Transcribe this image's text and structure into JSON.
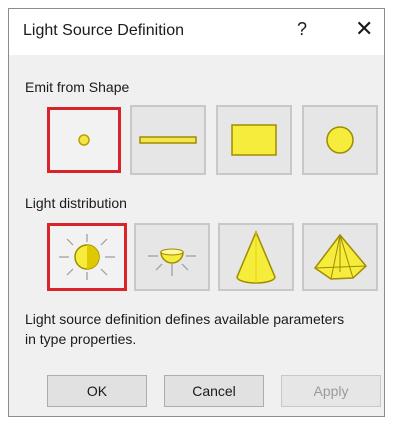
{
  "dialog": {
    "title": "Light Source Definition",
    "help_label": "?",
    "close_label": "✕"
  },
  "emit_from_shape": {
    "label": "Emit from Shape",
    "options": [
      {
        "icon": "point-light-icon",
        "selected": true
      },
      {
        "icon": "line-light-icon",
        "selected": false
      },
      {
        "icon": "rectangle-light-icon",
        "selected": false
      },
      {
        "icon": "circle-light-icon",
        "selected": false
      }
    ]
  },
  "light_distribution": {
    "label": "Light distribution",
    "options": [
      {
        "icon": "spherical-distribution-icon",
        "selected": true
      },
      {
        "icon": "hemispherical-distribution-icon",
        "selected": false
      },
      {
        "icon": "spot-cone-distribution-icon",
        "selected": false
      },
      {
        "icon": "photometric-web-distribution-icon",
        "selected": false
      }
    ]
  },
  "description": "Light source definition defines available parameters in type properties.",
  "buttons": {
    "ok": "OK",
    "cancel": "Cancel",
    "apply": "Apply"
  },
  "colors": {
    "selection_border": "#d9242b",
    "light_yellow": "#f2e64a"
  }
}
